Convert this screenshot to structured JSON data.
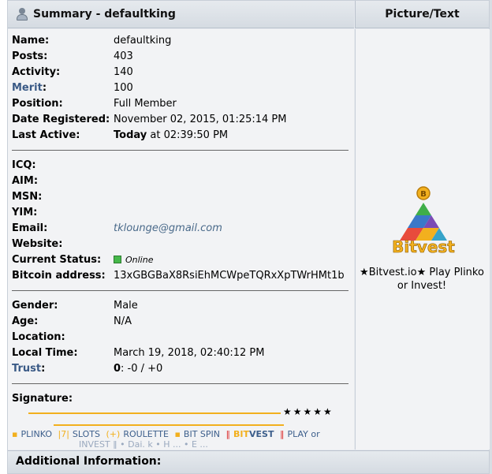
{
  "header": {
    "summary_title": "Summary - defaultking",
    "picture_title": "Picture/Text"
  },
  "profile": {
    "name_label": "Name:",
    "name": "defaultking",
    "posts_label": "Posts:",
    "posts": "403",
    "activity_label": "Activity:",
    "activity": "140",
    "merit_label": "Merit",
    "merit_colon": ":",
    "merit": "100",
    "position_label": "Position:",
    "position": "Full Member",
    "registered_label": "Date Registered:",
    "registered": "November 02, 2015, 01:25:14 PM",
    "last_active_label": "Last Active:",
    "last_active_day": "Today",
    "last_active_time": " at 02:39:50 PM"
  },
  "contact": {
    "icq_label": "ICQ:",
    "aim_label": "AIM:",
    "msn_label": "MSN:",
    "yim_label": "YIM:",
    "email_label": "Email:",
    "email": "tklounge@gmail.com",
    "website_label": "Website:",
    "status_label": "Current Status:",
    "status": "Online",
    "btc_label": "Bitcoin address:",
    "btc": "13xGBGBaX8RsiEhMCWpeTQRxXpTWrHMt1b"
  },
  "personal": {
    "gender_label": "Gender:",
    "gender": "Male",
    "age_label": "Age:",
    "age": "N/A",
    "location_label": "Location:",
    "local_time_label": "Local Time:",
    "local_time": "March 19, 2018, 02:40:12 PM",
    "trust_label": "Trust",
    "trust_colon": ":",
    "trust_score": "0",
    "trust_rest": ": -0 / +0"
  },
  "signature": {
    "label": "Signature:",
    "stars": "★★★★★",
    "items": [
      {
        "icon": "▪",
        "text": "PLINKO"
      },
      {
        "icon": "|7|",
        "text": "SLOTS"
      },
      {
        "icon": "(+)",
        "text": "ROULETTE"
      },
      {
        "icon": "▪",
        "text": "BIT SPIN"
      },
      {
        "icon": "BIT",
        "text": "VEST"
      },
      {
        "icon": "",
        "text": "PLAY or"
      }
    ],
    "cut_text": "INVEST ‖  • Dai. k  •  H  ...  •  E  ...",
    "accent_color": "#f2b01e"
  },
  "picture": {
    "logo_text": "Bitvest",
    "logo_coin": "B",
    "caption": "★Bitvest.io★ Play Plinko or Invest!"
  },
  "footer": {
    "additional_title": "Additional Information:"
  }
}
